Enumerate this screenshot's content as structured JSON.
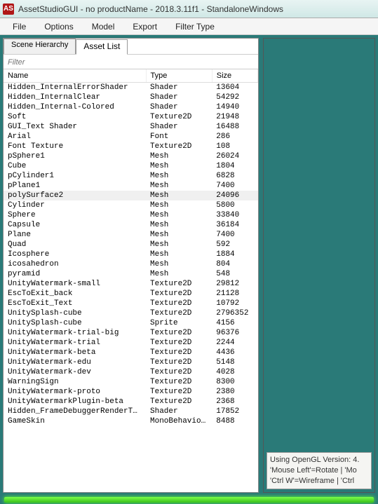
{
  "window": {
    "title": "AssetStudioGUI - no productName - 2018.3.11f1 - StandaloneWindows",
    "icon_letter": "AS"
  },
  "menu": [
    "File",
    "Options",
    "Model",
    "Export",
    "Filter Type"
  ],
  "tabs": [
    {
      "label": "Scene Hierarchy",
      "active": false
    },
    {
      "label": "Asset List",
      "active": true
    }
  ],
  "filter": {
    "placeholder": "Filter"
  },
  "columns": [
    "Name",
    "Type",
    "Size"
  ],
  "selected_index": 11,
  "rows": [
    {
      "name": "Hidden_InternalErrorShader",
      "type": "Shader",
      "size": "13604"
    },
    {
      "name": "Hidden_InternalClear",
      "type": "Shader",
      "size": "54292"
    },
    {
      "name": "Hidden_Internal-Colored",
      "type": "Shader",
      "size": "14940"
    },
    {
      "name": "Soft",
      "type": "Texture2D",
      "size": "21948"
    },
    {
      "name": "GUI_Text Shader",
      "type": "Shader",
      "size": "16488"
    },
    {
      "name": "Arial",
      "type": "Font",
      "size": "286"
    },
    {
      "name": "Font Texture",
      "type": "Texture2D",
      "size": "108"
    },
    {
      "name": "pSphere1",
      "type": "Mesh",
      "size": "26024"
    },
    {
      "name": "Cube",
      "type": "Mesh",
      "size": "1804"
    },
    {
      "name": "pCylinder1",
      "type": "Mesh",
      "size": "6828"
    },
    {
      "name": "pPlane1",
      "type": "Mesh",
      "size": "7400"
    },
    {
      "name": "polySurface2",
      "type": "Mesh",
      "size": "24096"
    },
    {
      "name": "Cylinder",
      "type": "Mesh",
      "size": "5800"
    },
    {
      "name": "Sphere",
      "type": "Mesh",
      "size": "33840"
    },
    {
      "name": "Capsule",
      "type": "Mesh",
      "size": "36184"
    },
    {
      "name": "Plane",
      "type": "Mesh",
      "size": "7400"
    },
    {
      "name": "Quad",
      "type": "Mesh",
      "size": "592"
    },
    {
      "name": "Icosphere",
      "type": "Mesh",
      "size": "1884"
    },
    {
      "name": "icosahedron",
      "type": "Mesh",
      "size": "804"
    },
    {
      "name": "pyramid",
      "type": "Mesh",
      "size": "548"
    },
    {
      "name": "UnityWatermark-small",
      "type": "Texture2D",
      "size": "29812"
    },
    {
      "name": "EscToExit_back",
      "type": "Texture2D",
      "size": "21128"
    },
    {
      "name": "EscToExit_Text",
      "type": "Texture2D",
      "size": "10792"
    },
    {
      "name": "UnitySplash-cube",
      "type": "Texture2D",
      "size": "2796352"
    },
    {
      "name": "UnitySplash-cube",
      "type": "Sprite",
      "size": "4156"
    },
    {
      "name": "UnityWatermark-trial-big",
      "type": "Texture2D",
      "size": "96376"
    },
    {
      "name": "UnityWatermark-trial",
      "type": "Texture2D",
      "size": "2244"
    },
    {
      "name": "UnityWatermark-beta",
      "type": "Texture2D",
      "size": "4436"
    },
    {
      "name": "UnityWatermark-edu",
      "type": "Texture2D",
      "size": "5148"
    },
    {
      "name": "UnityWatermark-dev",
      "type": "Texture2D",
      "size": "4028"
    },
    {
      "name": "WarningSign",
      "type": "Texture2D",
      "size": "8300"
    },
    {
      "name": "UnityWatermark-proto",
      "type": "Texture2D",
      "size": "2380"
    },
    {
      "name": "UnityWatermarkPlugin-beta",
      "type": "Texture2D",
      "size": "2368"
    },
    {
      "name": "Hidden_FrameDebuggerRenderTa...",
      "type": "Shader",
      "size": "17852"
    },
    {
      "name": "GameSkin",
      "type": "MonoBehaviour",
      "size": "8488"
    }
  ],
  "info": {
    "line1": "Using OpenGL Version: 4.",
    "line2": "'Mouse Left'=Rotate | 'Mo",
    "line3": "'Ctrl W'=Wireframe | 'Ctrl"
  }
}
